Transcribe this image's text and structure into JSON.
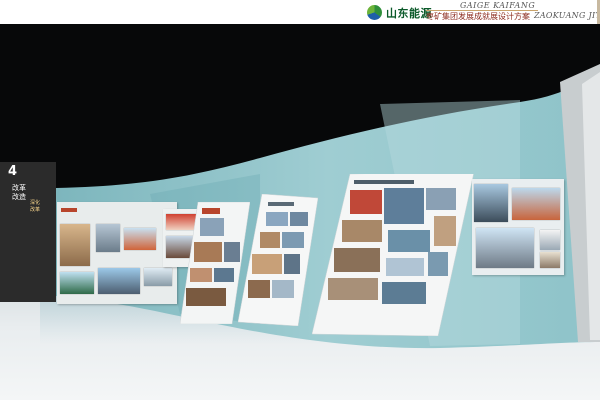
{
  "header": {
    "brand": "山东能源",
    "project_en_1": "GAIGE KAIFANG",
    "project_cn": "枣矿集团发展成就展设计方案",
    "project_en_2": "ZAOKUANG JITUA"
  },
  "exhibit": {
    "section_number": "4",
    "section_title": "改革改造",
    "section_subtitle": "深化改革"
  },
  "colors": {
    "wall": "#8fc2c8",
    "tower": "#2b2b2b",
    "accent": "#b8452c",
    "brand_green": "#0b5a2a"
  }
}
